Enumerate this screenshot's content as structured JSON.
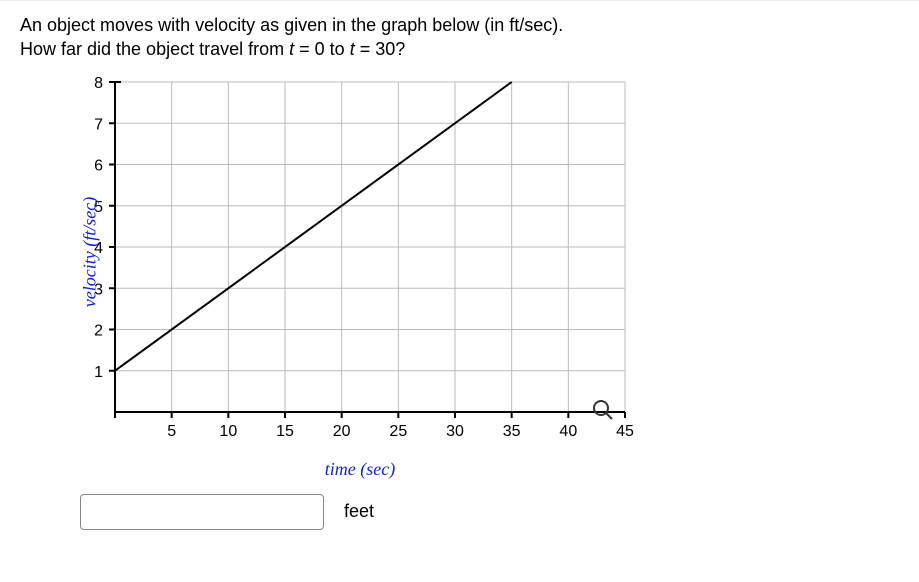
{
  "question_line1": "An object moves with velocity as given in the graph below (in ft/sec).",
  "question_line2_pre": "How far did the object travel from ",
  "question_line2_mid1": "t",
  "question_line2_eq1": " = 0 to ",
  "question_line2_mid2": "t",
  "question_line2_eq2": " = 30?",
  "answer_unit": "feet",
  "answer_value": "",
  "chart_data": {
    "type": "line",
    "title": "",
    "xlabel": "time (sec)",
    "ylabel": "velocity (ft/sec)",
    "xlim": [
      0,
      45
    ],
    "ylim": [
      0,
      8
    ],
    "x_ticks": [
      5,
      10,
      15,
      20,
      25,
      30,
      35,
      40,
      45
    ],
    "y_ticks": [
      1,
      2,
      3,
      4,
      5,
      6,
      7,
      8
    ],
    "series": [
      {
        "name": "velocity",
        "x": [
          0,
          35
        ],
        "y": [
          1,
          8
        ]
      }
    ]
  },
  "icons": {
    "zoom": "zoom-icon"
  }
}
